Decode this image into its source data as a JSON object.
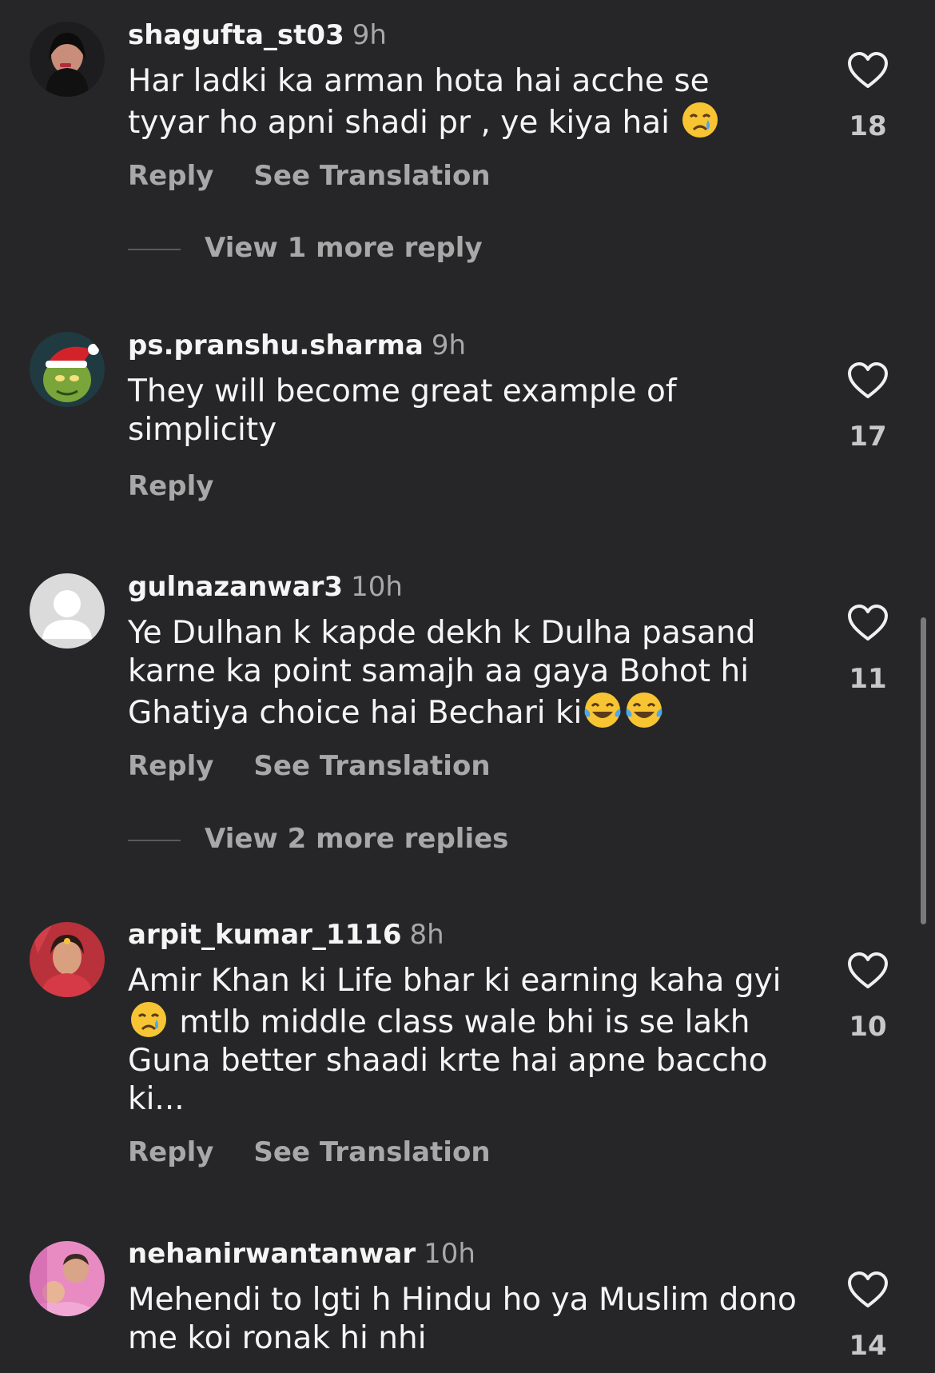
{
  "comments": [
    {
      "username": "shagufta_st03",
      "time": "9h",
      "text": "Har ladki ka arman hota hai acche se tyyar ho apni shadi pr , ye kiya hai",
      "emojis": [
        "crying-face"
      ],
      "likes": "18",
      "reply_label": "Reply",
      "translate_label": "See Translation",
      "more_replies": "View 1 more reply"
    },
    {
      "username": "ps.pranshu.sharma",
      "time": "9h",
      "text": "They will become great example of simplicity",
      "likes": "17",
      "reply_label": "Reply"
    },
    {
      "username": "gulnazanwar3",
      "time": "10h",
      "text": "Ye Dulhan k kapde dekh k Dulha pasand karne ka point samajh aa gaya Bohot hi Ghatiya choice hai Bechari ki",
      "emojis": [
        "tears-of-joy-face",
        "tears-of-joy-face"
      ],
      "likes": "11",
      "reply_label": "Reply",
      "translate_label": "See Translation",
      "more_replies": "View 2 more replies"
    },
    {
      "username": "arpit_kumar_1116",
      "time": "8h",
      "text_before_emoji": "Amir Khan ki Life bhar ki earning kaha gyi",
      "emojis": [
        "crying-face"
      ],
      "text_after_emoji": "mtlb middle class wale bhi is se lakh Guna better shaadi krte hai apne baccho ki...",
      "likes": "10",
      "reply_label": "Reply",
      "translate_label": "See Translation"
    },
    {
      "username": "nehanirwantanwar",
      "time": "10h",
      "text": "Mehendi to lgti h Hindu ho ya Muslim dono me koi ronak hi nhi",
      "likes": "14"
    }
  ],
  "colors": {
    "background": "#262628",
    "primary_text": "#f5f5f5",
    "secondary_text": "#a8a8a8"
  }
}
